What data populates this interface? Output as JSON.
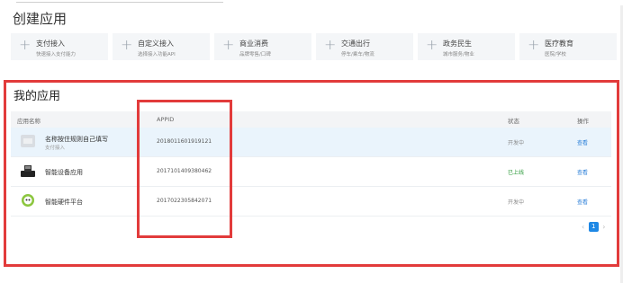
{
  "create": {
    "title": "创建应用",
    "cards": [
      {
        "title": "支付接入",
        "sub": "快速接入支付能力"
      },
      {
        "title": "自定义接入",
        "sub": "选择接入功能API"
      },
      {
        "title": "商业消费",
        "sub": "品牌零售/口碑"
      },
      {
        "title": "交通出行",
        "sub": "停车/乘车/物流"
      },
      {
        "title": "政务民生",
        "sub": "城市服务/物业"
      },
      {
        "title": "医疗教育",
        "sub": "医院/学校"
      }
    ]
  },
  "my_apps": {
    "title": "我的应用",
    "headers": {
      "name": "应用名称",
      "appid": "APPID",
      "status": "状态",
      "action": "操作"
    },
    "rows": [
      {
        "name": "名称按住规则自己填写",
        "sub": "支付接入",
        "appid": "2018011601919121",
        "status": "开发中",
        "action": "查看",
        "icon": "placeholder-icon"
      },
      {
        "name": "智能设备应用",
        "sub": "",
        "appid": "2017101409380462",
        "status": "已上线",
        "action": "查看",
        "icon": "pos-device-icon"
      },
      {
        "name": "智能硬件平台",
        "sub": "",
        "appid": "2017022305842071",
        "status": "开发中",
        "action": "查看",
        "icon": "robot-icon"
      }
    ],
    "pagination": {
      "prev": "‹",
      "current": "1",
      "next": "›"
    }
  },
  "colors": {
    "highlight_border": "#e23b3b",
    "accent": "#1e88e5",
    "online": "#2c9a3a"
  }
}
